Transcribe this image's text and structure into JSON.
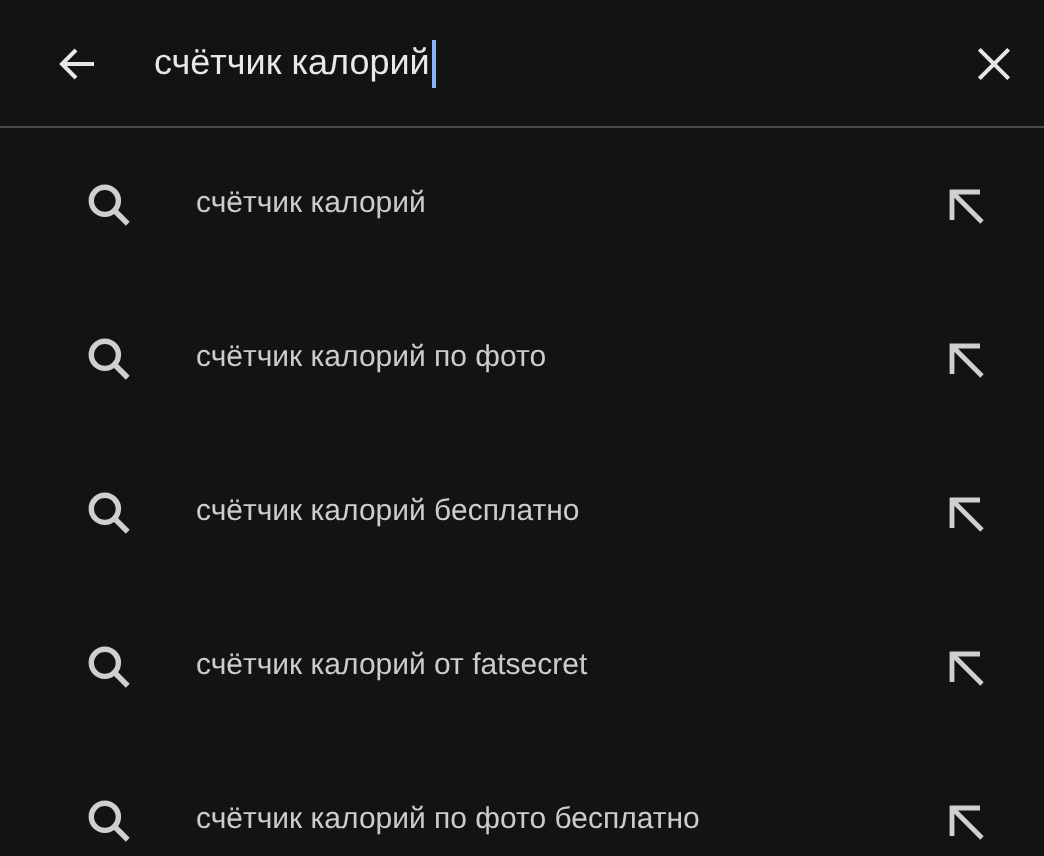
{
  "search": {
    "value": "счётчик калорий"
  },
  "suggestions": [
    {
      "text": "счётчик калорий"
    },
    {
      "text": "счётчик калорий по фото"
    },
    {
      "text": "счётчик калорий бесплатно"
    },
    {
      "text": "счётчик калорий от fatsecret"
    },
    {
      "text": "счётчик калорий по фото бесплатно"
    }
  ]
}
